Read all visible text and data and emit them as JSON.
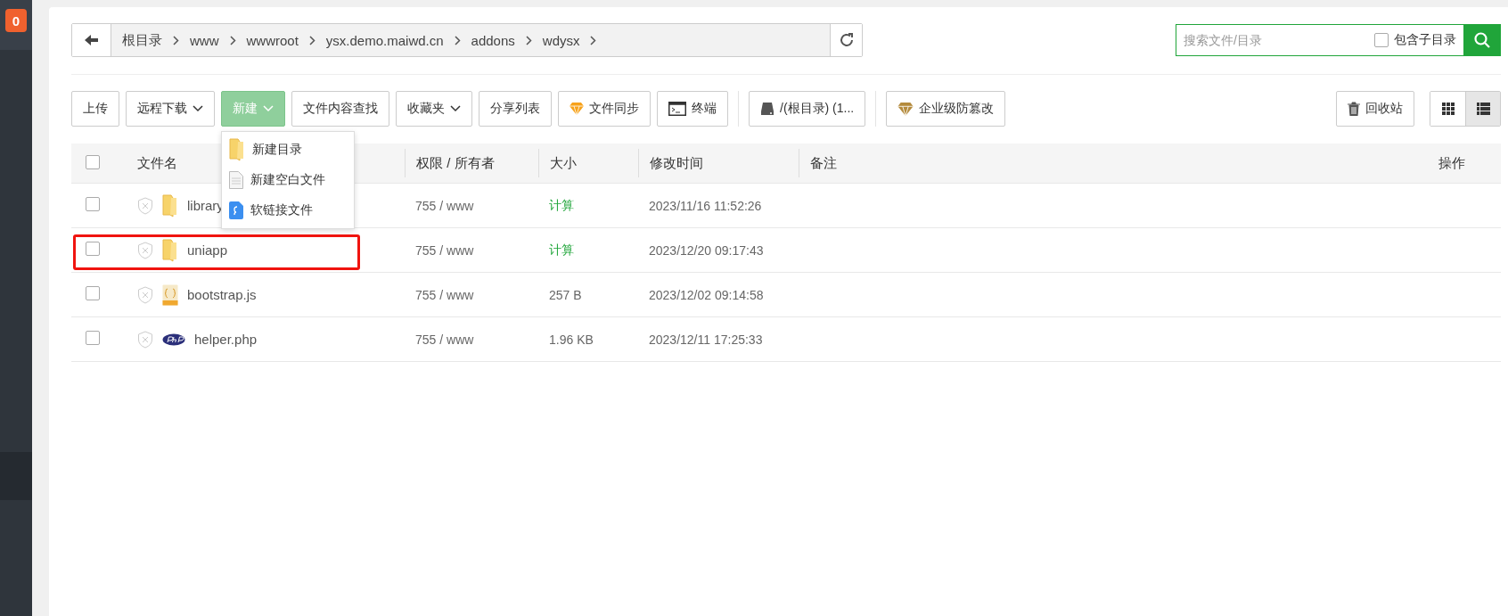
{
  "sidebar": {
    "badge": "0"
  },
  "breadcrumb": [
    "根目录",
    "www",
    "wwwroot",
    "ysx.demo.maiwd.cn",
    "addons",
    "wdysx"
  ],
  "search": {
    "placeholder": "搜索文件/目录",
    "include_subdirs": {
      "label": "包含子目录",
      "checked": false
    }
  },
  "toolbar": [
    {
      "label": "上传",
      "kind": "plain",
      "open": false
    },
    {
      "label": "远程下载",
      "kind": "menu",
      "open": false
    },
    {
      "label": "新建",
      "kind": "menu",
      "open": true
    },
    {
      "label": "文件内容查找",
      "kind": "plain",
      "open": false
    },
    {
      "label": "收藏夹",
      "kind": "menu",
      "open": false
    },
    {
      "label": "分享列表",
      "kind": "plain",
      "open": false
    },
    {
      "label": "文件同步",
      "kind": "sync",
      "open": false
    },
    {
      "label": "终端",
      "kind": "terminal",
      "open": false
    },
    {
      "label": "/(根目录) (1...",
      "kind": "disk",
      "open": false
    },
    {
      "label": "企业级防篡改",
      "kind": "tamper",
      "open": false
    }
  ],
  "new_menu": [
    {
      "label": "新建目录",
      "kind": "folder"
    },
    {
      "label": "新建空白文件",
      "kind": "file"
    },
    {
      "label": "软链接文件",
      "kind": "link"
    }
  ],
  "recycle_bin": {
    "label": "回收站"
  },
  "view_modes": [
    {
      "kind": "grid",
      "selected": false
    },
    {
      "kind": "list",
      "selected": true
    }
  ],
  "table": {
    "all_checked": false,
    "columns": [
      "文件名",
      "权限 / 所有者",
      "大小",
      "修改时间",
      "备注",
      "操作"
    ],
    "rows": [
      {
        "name": "library",
        "kind": "folder",
        "permission": "755 / www",
        "size": "计算",
        "size_link": true,
        "modified": "2023/11/16 11:52:26",
        "checked": false,
        "highlighted": false
      },
      {
        "name": "uniapp",
        "kind": "folder",
        "permission": "755 / www",
        "size": "计算",
        "size_link": true,
        "modified": "2023/12/20 09:17:43",
        "checked": false,
        "highlighted": true
      },
      {
        "name": "bootstrap.js",
        "kind": "js",
        "permission": "755 / www",
        "size": "257 B",
        "size_link": false,
        "modified": "2023/12/02 09:14:58",
        "checked": false,
        "highlighted": false
      },
      {
        "name": "helper.php",
        "kind": "php",
        "permission": "755 / www",
        "size": "1.96 KB",
        "size_link": false,
        "modified": "2023/12/11 17:25:33",
        "checked": false,
        "highlighted": false
      }
    ]
  }
}
